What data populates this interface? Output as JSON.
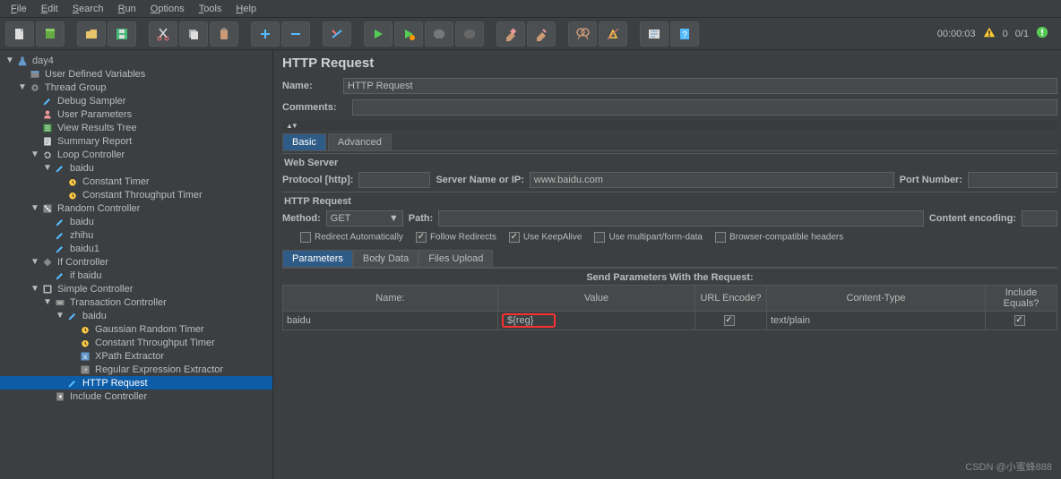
{
  "menu": {
    "items": [
      "File",
      "Edit",
      "Search",
      "Run",
      "Options",
      "Tools",
      "Help"
    ]
  },
  "toolbar": {
    "time": "00:00:03",
    "warn_count": "0",
    "err_count": "0/1"
  },
  "tree": [
    {
      "d": 0,
      "tw": "▼",
      "ic": "flask",
      "t": "day4"
    },
    {
      "d": 1,
      "tw": "",
      "ic": "vars",
      "t": "User Defined Variables"
    },
    {
      "d": 1,
      "tw": "▼",
      "ic": "gear",
      "t": "Thread Group"
    },
    {
      "d": 2,
      "tw": "",
      "ic": "pencil",
      "t": "Debug Sampler"
    },
    {
      "d": 2,
      "tw": "",
      "ic": "userp",
      "t": "User Parameters"
    },
    {
      "d": 2,
      "tw": "",
      "ic": "tree",
      "t": "View Results Tree"
    },
    {
      "d": 2,
      "tw": "",
      "ic": "report",
      "t": "Summary Report"
    },
    {
      "d": 2,
      "tw": "▼",
      "ic": "loop",
      "t": "Loop Controller"
    },
    {
      "d": 3,
      "tw": "▼",
      "ic": "pencil",
      "t": "baidu"
    },
    {
      "d": 4,
      "tw": "",
      "ic": "timer",
      "t": "Constant Timer"
    },
    {
      "d": 4,
      "tw": "",
      "ic": "timer",
      "t": "Constant Throughput Timer"
    },
    {
      "d": 2,
      "tw": "▼",
      "ic": "rand",
      "t": "Random Controller"
    },
    {
      "d": 3,
      "tw": "",
      "ic": "pencil",
      "t": "baidu"
    },
    {
      "d": 3,
      "tw": "",
      "ic": "pencil",
      "t": "zhihu"
    },
    {
      "d": 3,
      "tw": "",
      "ic": "pencil",
      "t": "baidu1"
    },
    {
      "d": 2,
      "tw": "▼",
      "ic": "if",
      "t": "If Controller"
    },
    {
      "d": 3,
      "tw": "",
      "ic": "pencil",
      "t": "if baidu"
    },
    {
      "d": 2,
      "tw": "▼",
      "ic": "simple",
      "t": "Simple Controller"
    },
    {
      "d": 3,
      "tw": "▼",
      "ic": "trans",
      "t": "Transaction Controller"
    },
    {
      "d": 4,
      "tw": "▼",
      "ic": "pencil",
      "t": "baidu"
    },
    {
      "d": 5,
      "tw": "",
      "ic": "timer",
      "t": "Gaussian Random Timer"
    },
    {
      "d": 5,
      "tw": "",
      "ic": "timer",
      "t": "Constant Throughput Timer"
    },
    {
      "d": 5,
      "tw": "",
      "ic": "xpath",
      "t": "XPath Extractor"
    },
    {
      "d": 5,
      "tw": "",
      "ic": "regex",
      "t": "Regular Expression Extractor"
    },
    {
      "d": 4,
      "tw": "",
      "ic": "pencil",
      "t": "HTTP Request",
      "sel": true
    },
    {
      "d": 3,
      "tw": "",
      "ic": "include",
      "t": "Include Controller"
    }
  ],
  "page": {
    "title": "HTTP Request",
    "name_label": "Name:",
    "name_value": "HTTP Request",
    "comments_label": "Comments:",
    "comments_value": "",
    "tabs": {
      "basic": "Basic",
      "advanced": "Advanced"
    },
    "webserver_title": "Web Server",
    "protocol_label": "Protocol [http]:",
    "protocol_value": "",
    "server_label": "Server Name or IP:",
    "server_value": "www.baidu.com",
    "port_label": "Port Number:",
    "port_value": "",
    "http_title": "HTTP Request",
    "method_label": "Method:",
    "method_value": "GET",
    "path_label": "Path:",
    "path_value": "",
    "encoding_label": "Content encoding:",
    "encoding_value": "",
    "cb": {
      "redirect_auto": "Redirect Automatically",
      "follow": "Follow Redirects",
      "keepalive": "Use KeepAlive",
      "multipart": "Use multipart/form-data",
      "browser": "Browser-compatible headers"
    },
    "ptabs": {
      "params": "Parameters",
      "body": "Body Data",
      "files": "Files Upload"
    },
    "param_caption": "Send Parameters With the Request:",
    "cols": {
      "name": "Name:",
      "value": "Value",
      "url": "URL Encode?",
      "ctype": "Content-Type",
      "inc": "Include Equals?"
    },
    "row": {
      "name": "baidu",
      "value": "${reg}",
      "url": true,
      "ctype": "text/plain",
      "inc": true
    }
  },
  "watermark": "CSDN @小蜜蜂888"
}
